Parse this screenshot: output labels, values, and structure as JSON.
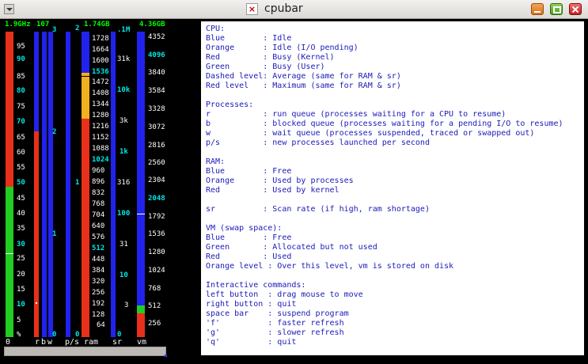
{
  "window": {
    "title": "cpubar",
    "app_icon": "x11-app-icon",
    "buttons": [
      "minimize",
      "maximize",
      "close"
    ]
  },
  "top_values": {
    "cpu_freq": "1.9GHz",
    "bw": "107",
    "ram_total": "1.74GB",
    "sr": ".1M",
    "vm_total": "4.36GB",
    "pz": "2",
    "bw_mark": "3"
  },
  "cpu_scale": [
    "95",
    "90",
    "85",
    "80",
    "75",
    "70",
    "65",
    "60",
    "55",
    "50",
    "45",
    "40",
    "35",
    "30",
    "25",
    "20",
    "15",
    "10",
    "5"
  ],
  "b_scale": [
    "2",
    "1"
  ],
  "ps_scale": [
    "1"
  ],
  "ram_scale": [
    "1728",
    "1664",
    "1600",
    "1536",
    "1472",
    "1408",
    "1344",
    "1280",
    "1216",
    "1152",
    "1088",
    "1024",
    "960",
    "896",
    "832",
    "768",
    "704",
    "640",
    "576",
    "512",
    "448",
    "384",
    "320",
    "256",
    "192",
    "128",
    "64"
  ],
  "sr_scale": [
    "31k",
    "10k",
    "3k",
    "1k",
    "316",
    "100",
    "31",
    "10",
    "3"
  ],
  "vm_scale": [
    "4352",
    "4096",
    "3840",
    "3584",
    "3328",
    "3072",
    "2816",
    "2560",
    "2304",
    "2048",
    "1792",
    "1536",
    "1280",
    "1024",
    "768",
    "512",
    "256"
  ],
  "bottom_labels": {
    "cpu": "0",
    "cpu_unit": "%",
    "r": "r",
    "b": "b",
    "w": "w",
    "ps": "p/s",
    "ram": "ram",
    "sr": "sr",
    "vm": "vm",
    "zero_b": "0",
    "zero_ps": "0",
    "zero_sr": "0"
  },
  "help_text": "CPU:\nBlue        : Idle\nOrange      : Idle (I/O pending)\nRed         : Busy (Kernel)\nGreen       : Busy (User)\nDashed level: Average (same for RAM & sr)\nRed level   : Maximum (same for RAM & sr)\n\nProcesses:\nr           : run queue (processes waiting for a CPU to resume)\nb           : blocked queue (processes waiting for a pending I/O to resume)\nw           : wait queue (processes suspended, traced or swapped out)\np/s         : new processes launched per second\n\nRAM:\nBlue        : Free\nOrange      : Used by processes\nRed         : Used by kernel\n\nsr          : Scan rate (if high, ram shortage)\n\nVM (swap space):\nBlue        : Free\nGreen       : Allocated but not used\nRed         : Used\nOrange level : Over this level, vm is stored on disk\n\nInteractive commands:\nleft button  : drag mouse to move\nright button : quit\nspace bar    : suspend program\n'f'          : faster refresh\n'g'          : slower refresh\n'q'          : quit",
  "colors": {
    "idle_blue": "#2222ee",
    "io_orange": "#f0b020",
    "kernel_red": "#e8301a",
    "user_green": "#22cc22",
    "help_text": "#1a1ab8"
  }
}
